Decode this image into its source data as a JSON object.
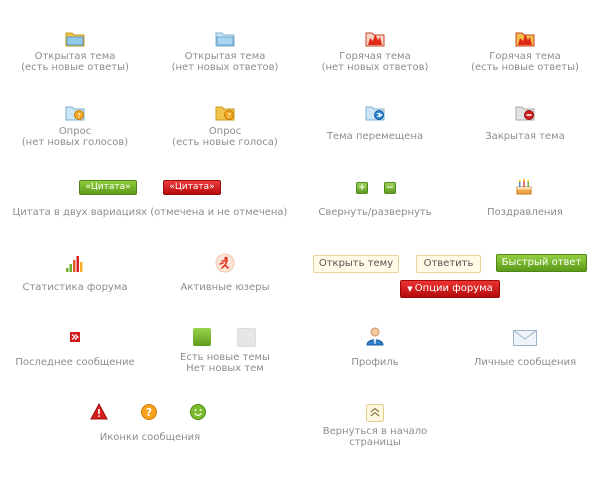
{
  "row1": {
    "open_new": "Открытая тема\n(есть новые ответы)",
    "open_none": "Открытая тема\n(нет новых ответов)",
    "hot_new": "Горячая тема\n(нет новых ответов)",
    "hot_none": "Горячая тема\n(есть новые ответы)"
  },
  "row2": {
    "poll_none": "Опрос\n(нет новых голосов)",
    "poll_new": "Опрос\n(есть новые голоса)",
    "moved": "Тема перемещена",
    "closed": "Закрытая тема"
  },
  "row3": {
    "quote_btn_green": "«Цитата»",
    "quote_btn_red": "«Цитата»",
    "quote_caption": "Цитата в двух вариациях (отмечена и не отмечена)",
    "collapse_plus": "+",
    "collapse_minus": "−",
    "collapse_caption": "Свернуть/развернуть",
    "birthday_caption": "Поздравления"
  },
  "row4": {
    "stats_caption": "Статистика форума",
    "active_caption": "Активные юзеры",
    "btn_open_topic": "Открыть тему",
    "btn_reply": "Ответить",
    "btn_quick_reply": "Быстрый ответ",
    "btn_forum_options": "Опции форума"
  },
  "row5": {
    "last_post": "Последнее сообщение",
    "new_topics": "Есть новые темы\nНет новых тем",
    "profile": "Профиль",
    "pm": "Личные сообщения"
  },
  "row6": {
    "post_icons": "Иконки сообщения",
    "back_to_top": "Вернуться в начало\nстраницы"
  },
  "colors": {
    "caption": "#8d8d8d",
    "green": "#6aaa22",
    "red": "#c81414",
    "folder_blue": "#8ec8ea",
    "folder_yellow": "#f5c64a"
  }
}
